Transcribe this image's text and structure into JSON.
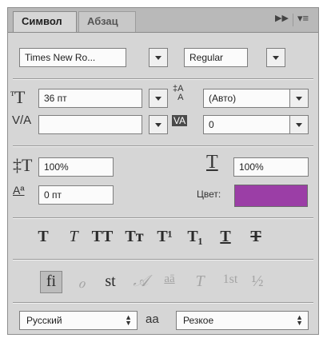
{
  "tabs": [
    {
      "label": "Символ",
      "active": true
    },
    {
      "label": "Абзац",
      "active": false
    }
  ],
  "header_icons": {
    "collapse": "double-arrow-icon",
    "menu": "panel-menu-icon"
  },
  "font": {
    "family": "Times New Ro...",
    "style": "Regular"
  },
  "size": {
    "value": "36 пт"
  },
  "leading": {
    "value": "(Авто)"
  },
  "kerning": {
    "value": ""
  },
  "tracking": {
    "value": "0"
  },
  "vertical_scale": {
    "value": "100%"
  },
  "horizontal_scale": {
    "value": "100%"
  },
  "baseline_shift": {
    "value": "0 пт"
  },
  "color": {
    "label": "Цвет:",
    "swatch": "#9b3ea6"
  },
  "style_buttons": [
    {
      "name": "faux-bold",
      "glyph": "T"
    },
    {
      "name": "faux-italic",
      "glyph": "T"
    },
    {
      "name": "all-caps",
      "glyph": "TT"
    },
    {
      "name": "small-caps",
      "glyph": "Tт"
    },
    {
      "name": "superscript",
      "glyph": "T¹"
    },
    {
      "name": "subscript",
      "glyph": "T₁"
    },
    {
      "name": "underline",
      "glyph": "T"
    },
    {
      "name": "strikethrough",
      "glyph": "T"
    }
  ],
  "opentype_buttons": [
    {
      "name": "standard-ligatures",
      "glyph": "fi",
      "enabled": true
    },
    {
      "name": "contextual-alternates",
      "glyph": "ℴ",
      "enabled": false
    },
    {
      "name": "discretionary-ligatures",
      "glyph": "st",
      "enabled": true
    },
    {
      "name": "swash",
      "glyph": "𝒜",
      "enabled": false
    },
    {
      "name": "stylistic-alternates",
      "glyph": "aā",
      "enabled": false
    },
    {
      "name": "titling-alternates",
      "glyph": "T",
      "enabled": false
    },
    {
      "name": "ordinals",
      "glyph": "1st",
      "enabled": false
    },
    {
      "name": "fractions",
      "glyph": "½",
      "enabled": false
    }
  ],
  "language": {
    "value": "Русский"
  },
  "antialias": {
    "icon_text": "aa",
    "value": "Резкое"
  }
}
